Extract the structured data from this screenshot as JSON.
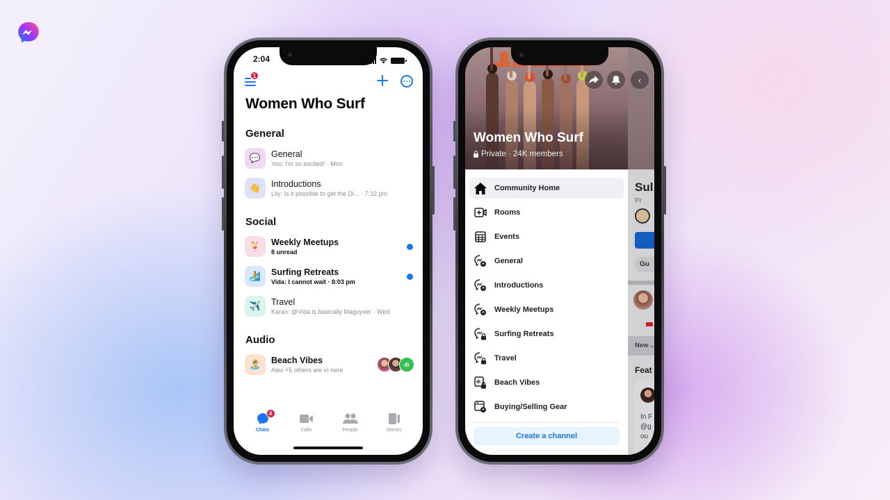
{
  "brand": {
    "logo": "messenger-logo-icon",
    "accent": "#1877f2"
  },
  "left_phone": {
    "status_bar": {
      "time": "2:04",
      "icons": [
        "signal-icon",
        "wifi-icon",
        "battery-icon"
      ]
    },
    "header": {
      "menu_badge": "1",
      "title": "Women Who Surf",
      "actions": [
        "plus-icon",
        "more-icon"
      ]
    },
    "sections": [
      {
        "heading": "General",
        "channels": [
          {
            "name": "General",
            "subtitle": "You: I'm so excited! · Mon",
            "icon": "💬",
            "icon_bg": "#f1d9f5",
            "unread": false
          },
          {
            "name": "Introductions",
            "subtitle": "Lily: Is it possible to get the Di... · 7:32 pm",
            "icon": "👋",
            "icon_bg": "#dfe1fb",
            "unread": false
          }
        ]
      },
      {
        "heading": "Social",
        "channels": [
          {
            "name": "Weekly Meetups",
            "subtitle": "8 unread",
            "icon": "🍹",
            "icon_bg": "#fbdde6",
            "unread": true
          },
          {
            "name": "Surfing Retreats",
            "subtitle": "Vida: I cannot wait · 8:03 pm",
            "icon": "🏄",
            "icon_bg": "#d9e8fb",
            "unread": true
          },
          {
            "name": "Travel",
            "subtitle": "Karan: @Vida is basically Maguyver · Wed",
            "icon": "✈️",
            "icon_bg": "#dcf5ea",
            "unread": false
          }
        ]
      },
      {
        "heading": "Audio",
        "channels": [
          {
            "name": "Beach Vibes",
            "subtitle": "Alex +5 others are in here",
            "icon": "🏝️",
            "icon_bg": "#fde2cf",
            "unread": false,
            "live_audio": true
          }
        ]
      }
    ],
    "tab_bar": [
      {
        "label": "Chats",
        "icon": "chats-icon",
        "active": true,
        "badge": "4"
      },
      {
        "label": "Calls",
        "icon": "video-camera-icon",
        "active": false
      },
      {
        "label": "People",
        "icon": "people-icon",
        "active": false
      },
      {
        "label": "Stories",
        "icon": "stories-icon",
        "active": false
      }
    ]
  },
  "right_phone": {
    "hero": {
      "title": "Women Who Surf",
      "subtitle": "Private · 24K members",
      "buttons": [
        "share-icon",
        "bell-icon"
      ],
      "back_button": "‹"
    },
    "nav_items": [
      {
        "label": "Community Home",
        "icon": "home-icon",
        "active": true
      },
      {
        "label": "Rooms",
        "icon": "rooms-icon",
        "active": false
      },
      {
        "label": "Events",
        "icon": "calendar-icon",
        "active": false
      },
      {
        "label": "General",
        "icon": "chat-group-icon",
        "active": false
      },
      {
        "label": "Introductions",
        "icon": "chat-group-icon",
        "active": false
      },
      {
        "label": "Weekly Meetups",
        "icon": "chat-group-icon",
        "active": false
      },
      {
        "label": "Surfing Retreats",
        "icon": "chat-group-locked-icon",
        "active": false
      },
      {
        "label": "Travel",
        "icon": "chat-group-locked-icon",
        "active": false
      },
      {
        "label": "Beach Vibes",
        "icon": "audio-channel-locked-icon",
        "active": false
      },
      {
        "label": "Buying/Selling Gear",
        "icon": "marketplace-channel-icon",
        "active": false
      }
    ],
    "create_button": "Create a channel",
    "behind_page": {
      "title": "Sul",
      "subtitle": "Pr",
      "chip": "Gu",
      "new_banner": "New ...",
      "featured": "Feat",
      "card_text": [
        "In F",
        "@g",
        "ou"
      ]
    }
  }
}
